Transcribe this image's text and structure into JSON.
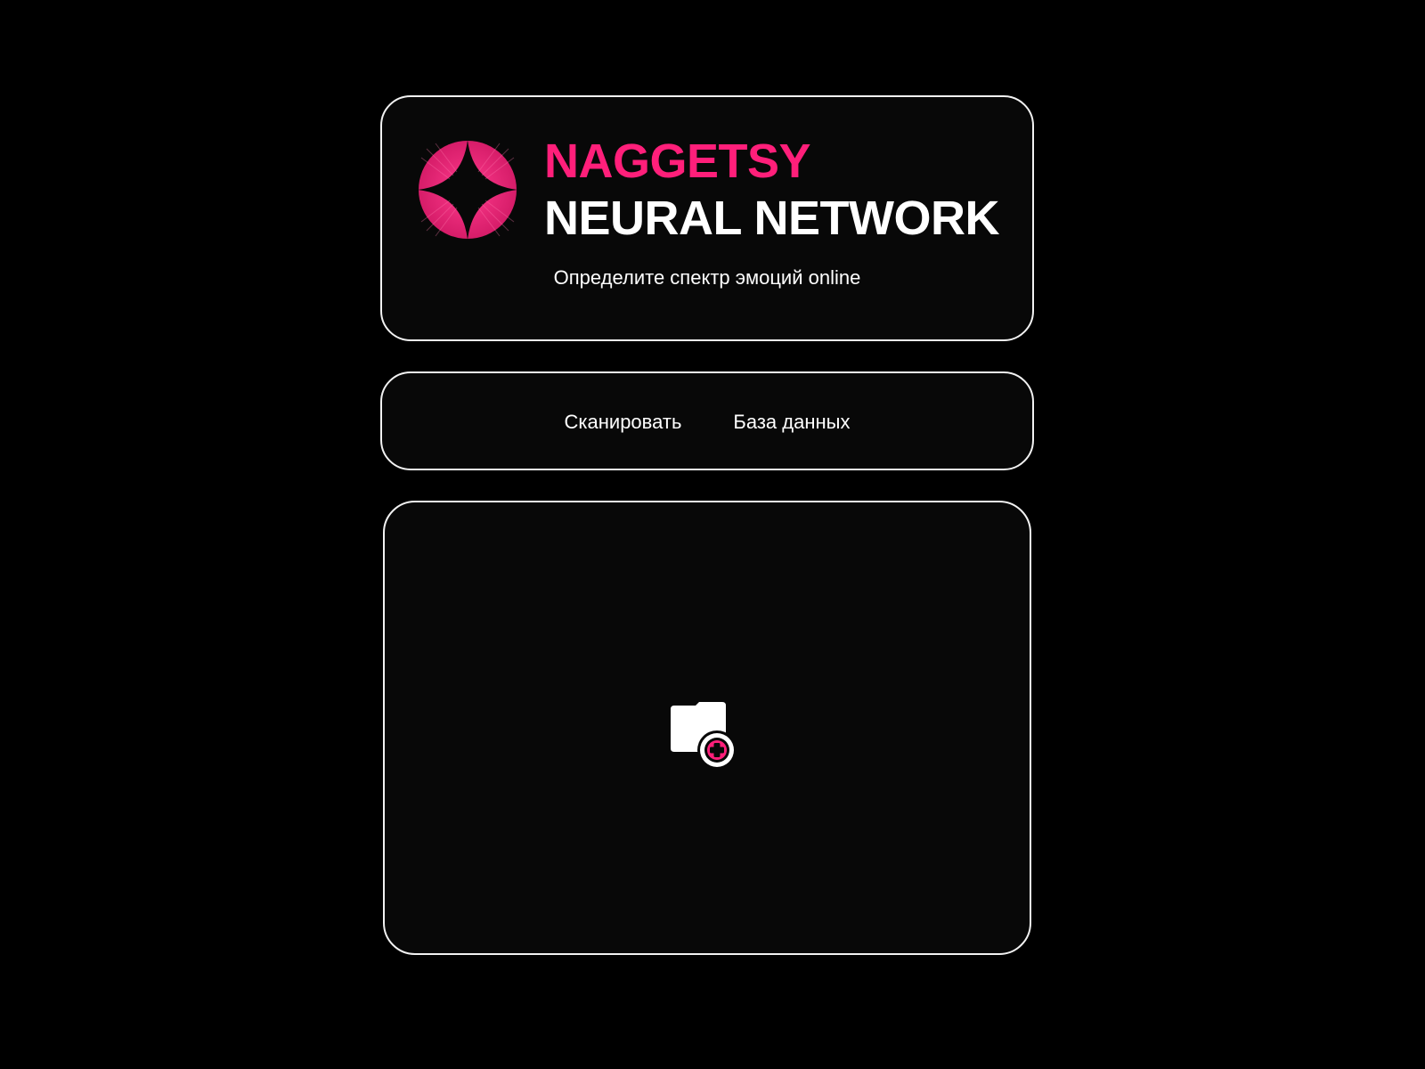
{
  "header": {
    "logo_icon": "pink-star-badge-icon",
    "brand_line1": "NAGGETSY",
    "brand_line2": "NEURAL NETWORK",
    "tagline": "Определите спектр эмоций online"
  },
  "nav": {
    "items": [
      {
        "label": "Сканировать"
      },
      {
        "label": "База данных"
      }
    ]
  },
  "upload": {
    "icon": "folder-add-icon"
  },
  "colors": {
    "background": "#000000",
    "card_background": "#080808",
    "card_border": "#f2f2f2",
    "accent": "#ff1f7a",
    "text": "#ffffff"
  }
}
